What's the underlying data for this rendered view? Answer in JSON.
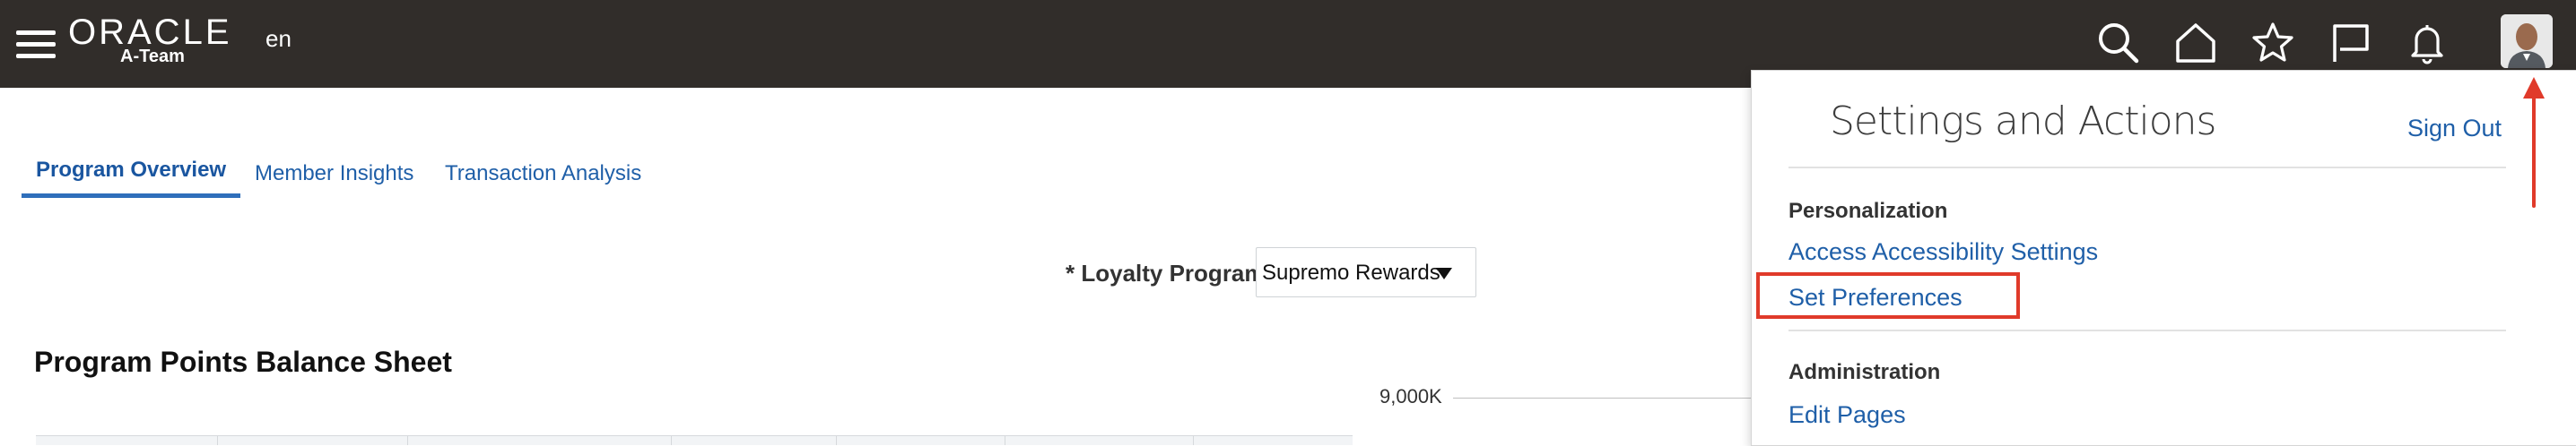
{
  "header": {
    "logo_text": "ORACLE",
    "logo_sub": "A-Team",
    "language": "en",
    "icons": [
      "menu-icon",
      "search-icon",
      "home-icon",
      "favorites-icon",
      "flag-icon",
      "notifications-icon",
      "avatar"
    ]
  },
  "tabs": [
    {
      "label": "Program Overview",
      "active": true
    },
    {
      "label": "Member Insights",
      "active": false
    },
    {
      "label": "Transaction Analysis",
      "active": false
    }
  ],
  "filter": {
    "label": "* Loyalty Program",
    "value": "Supremo Rewards"
  },
  "section": {
    "title": "Program Points Balance Sheet"
  },
  "chart_axis": {
    "tick_label": "9,000K"
  },
  "settings_popup": {
    "title": "Settings and Actions",
    "sign_out": "Sign Out",
    "sections": [
      {
        "heading": "Personalization",
        "links": [
          "Access Accessibility Settings",
          "Set Preferences"
        ]
      },
      {
        "heading": "Administration",
        "links": [
          "Edit Pages"
        ]
      }
    ],
    "highlighted_link": "Set Preferences"
  },
  "colors": {
    "topbar": "#312d2a",
    "link": "#1f5fa8",
    "highlight": "#e03a2a"
  }
}
